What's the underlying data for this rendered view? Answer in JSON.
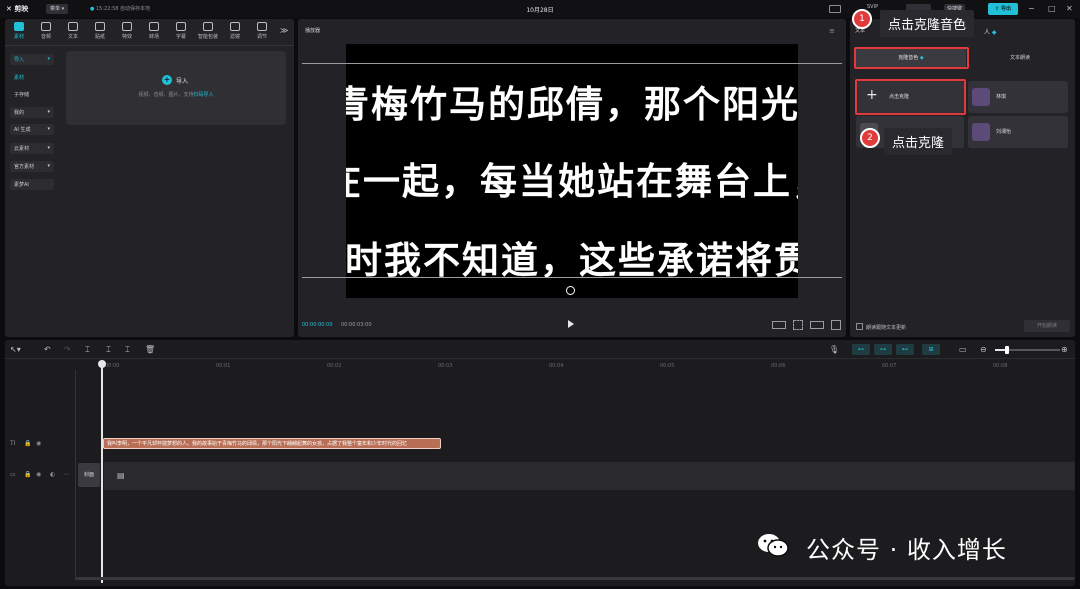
{
  "titlebar": {
    "logo": "剪映",
    "menu": "菜单",
    "save_status": "15:22:58 自动保存本地",
    "title": "10月28日",
    "shortcut": "快捷键",
    "export": "导出"
  },
  "tools": [
    {
      "label": "素材",
      "icon": "media-icon"
    },
    {
      "label": "音频",
      "icon": "audio-icon"
    },
    {
      "label": "文本",
      "icon": "text-icon"
    },
    {
      "label": "贴纸",
      "icon": "sticker-icon"
    },
    {
      "label": "特效",
      "icon": "effects-icon"
    },
    {
      "label": "转场",
      "icon": "transition-icon"
    },
    {
      "label": "字幕",
      "icon": "caption-icon"
    },
    {
      "label": "智能包装",
      "icon": "smart-pack-icon"
    },
    {
      "label": "滤镜",
      "icon": "filter-icon"
    },
    {
      "label": "调节",
      "icon": "adjust-icon"
    }
  ],
  "sidebar": {
    "items": [
      "导入",
      "素材",
      "子存储",
      "我的",
      "AI 生成",
      "云素材",
      "官方素材",
      "素梦AI"
    ]
  },
  "import": {
    "label": "导入",
    "hint": "视频、音频、图片，支持",
    "hint_link": "扫码导入"
  },
  "player": {
    "label": "播放器",
    "lines": [
      "青梅竹马的邱倩，那个阳光下的",
      "在一起，每当她站在舞台上，",
      "那时我不知道，这些承诺将贯"
    ],
    "current_time": "00:00:00:00",
    "duration": "00:00:03:00"
  },
  "right_panel": {
    "tab1": "文本",
    "tab2": "朗读",
    "tab_person": "人",
    "subtab_clone": "克隆音色",
    "subtab_tts": "文本朗读",
    "clone_button": "点击克隆",
    "voice1": "林琪",
    "voice2": "刘湘怡",
    "checkbox_label": "朗读跟随文本更新",
    "start_read": "开始朗读"
  },
  "annotations": {
    "step1_num": "1",
    "step1_label": "点击克隆音色",
    "step2_num": "2",
    "step2_label": "点击克隆"
  },
  "timeline": {
    "ruler": [
      "00:00",
      "00:01",
      "00:02",
      "00:03",
      "00:04",
      "00:05",
      "00:06",
      "00:07",
      "00:08"
    ],
    "text_clip": "我叫李明，一个平凡却怀揣梦想的人。我的故事始于青梅竹马的邱倩，那个阳光下翩翩起舞的女孩，占据了我整个童年和少年时代的回忆",
    "cover": "封面"
  },
  "watermark": "公众号 · 收入增长"
}
